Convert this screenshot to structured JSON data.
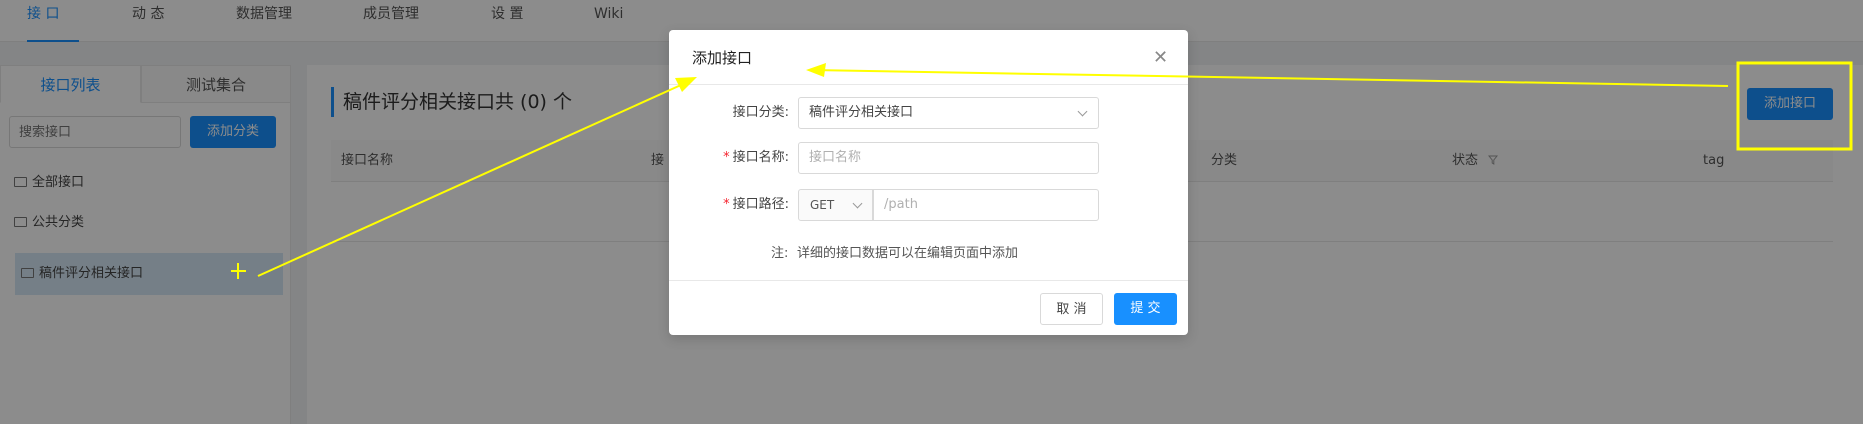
{
  "nav": {
    "tabs": [
      {
        "label": "接 口"
      },
      {
        "label": "动 态"
      },
      {
        "label": "数据管理"
      },
      {
        "label": "成员管理"
      },
      {
        "label": "设 置"
      },
      {
        "label": "Wiki"
      }
    ]
  },
  "sidebar": {
    "tabs": [
      {
        "label": "接口列表"
      },
      {
        "label": "测试集合"
      }
    ],
    "search_placeholder": "搜索接口",
    "add_category_label": "添加分类",
    "tree": [
      {
        "label": "全部接口"
      },
      {
        "label": "公共分类"
      },
      {
        "label": "稿件评分相关接口"
      }
    ]
  },
  "main": {
    "title": "稿件评分相关接口共 (0) 个",
    "add_interface_label": "添加接口",
    "columns": [
      "接口名称",
      "接",
      "分类",
      "状态",
      "tag"
    ]
  },
  "modal": {
    "title": "添加接口",
    "close_glyph": "✕",
    "fields": {
      "category_label": "接口分类:",
      "category_value": "稿件评分相关接口",
      "name_label": "接口名称:",
      "name_placeholder": "接口名称",
      "path_label": "接口路径:",
      "method_value": "GET",
      "path_placeholder": "/path",
      "required_mark": "*"
    },
    "note_label": "注:",
    "note_text": "详细的接口数据可以在编辑页面中添加",
    "cancel_label": "取 消",
    "submit_label": "提 交"
  },
  "colors": {
    "accent": "#1890ff",
    "annotation": "#ffff00",
    "required": "#f5222d"
  }
}
